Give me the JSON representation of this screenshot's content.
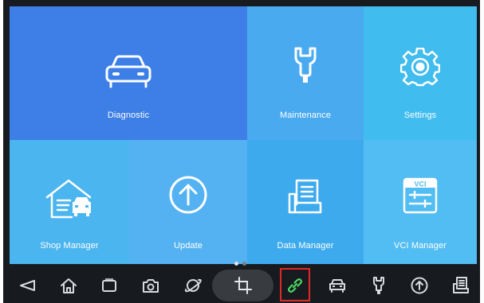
{
  "tiles": {
    "diagnostic": {
      "label": "Diagnostic"
    },
    "maintenance": {
      "label": "Maintenance"
    },
    "settings": {
      "label": "Settings"
    },
    "shop_manager": {
      "label": "Shop Manager"
    },
    "update": {
      "label": "Update"
    },
    "data_manager": {
      "label": "Data Manager"
    },
    "vci_manager": {
      "label": "VCI Manager",
      "icon_text": "VCI"
    }
  },
  "pager": {
    "pages": 2,
    "current": 1
  },
  "navbar": {
    "items": [
      "back-icon",
      "home-icon",
      "recent-apps-icon",
      "camera-icon",
      "browser-icon",
      "crop-icon",
      "link-icon",
      "car-icon",
      "wrench-icon",
      "update-icon",
      "report-icon"
    ],
    "highlighted": "link-icon"
  },
  "colors": {
    "diagnostic_tile": "#3d7fe6",
    "tile_blue": "#4aaaf0",
    "navbar_bg": "#171b1f",
    "highlight_border": "#e02828",
    "link_icon": "#4cd964"
  }
}
